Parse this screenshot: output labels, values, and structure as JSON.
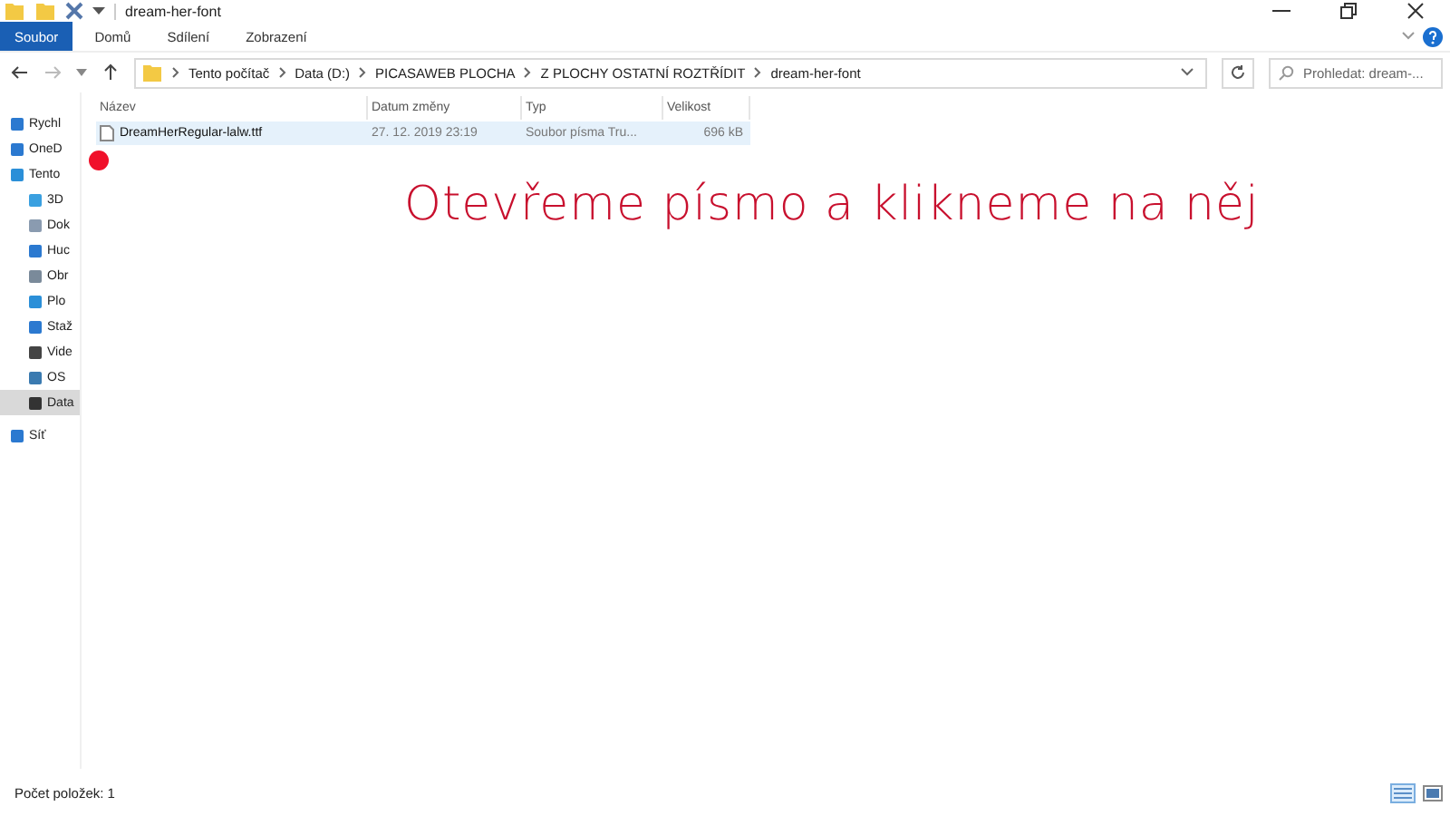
{
  "window": {
    "title": "dream-her-font"
  },
  "ribbon_tabs": [
    {
      "label": "Soubor",
      "selected": true
    },
    {
      "label": "Domů",
      "selected": false
    },
    {
      "label": "Sdílení",
      "selected": false
    },
    {
      "label": "Zobrazení",
      "selected": false
    }
  ],
  "address_bar": {
    "path": [
      "Tento počítač",
      "Data (D:)",
      "PICASAWEB PLOCHA",
      "Z PLOCHY OSTATNÍ ROZTŘÍDIT",
      "dream-her-font"
    ]
  },
  "search": {
    "placeholder": "Prohledat: dream-..."
  },
  "sidebar": {
    "items": [
      {
        "label": "Rychl",
        "kind": "star",
        "selected": false
      },
      {
        "label": "OneD",
        "kind": "cloud",
        "selected": false
      },
      {
        "label": "Tento",
        "kind": "pc",
        "selected": false,
        "children": [
          {
            "label": "3D",
            "kind": "cube",
            "selected": false
          },
          {
            "label": "Dok",
            "kind": "doc",
            "selected": false
          },
          {
            "label": "Huc",
            "kind": "music",
            "selected": false
          },
          {
            "label": "Obr",
            "kind": "picture",
            "selected": false
          },
          {
            "label": "Plo",
            "kind": "desktop",
            "selected": false
          },
          {
            "label": "Staž",
            "kind": "download",
            "selected": false
          },
          {
            "label": "Vide",
            "kind": "video",
            "selected": false
          },
          {
            "label": "OS",
            "kind": "drive",
            "selected": false
          },
          {
            "label": "Data",
            "kind": "disk",
            "selected": true
          }
        ]
      },
      {
        "label": "Síť",
        "kind": "network",
        "selected": false
      }
    ]
  },
  "table": {
    "columns": [
      "Název",
      "Datum změny",
      "Typ",
      "Velikost"
    ],
    "rows": [
      {
        "cells": [
          "DreamHerRegular-lalw.ttf",
          "27. 12. 2019 23:19",
          "Soubor písma Tru...",
          "696 kB"
        ],
        "selected": true
      }
    ]
  },
  "overlay": {
    "caption": "Otevřeme písmo a klikneme na něj",
    "click_marker": true
  },
  "status_bar": {
    "text": "Počet položek: 1"
  }
}
